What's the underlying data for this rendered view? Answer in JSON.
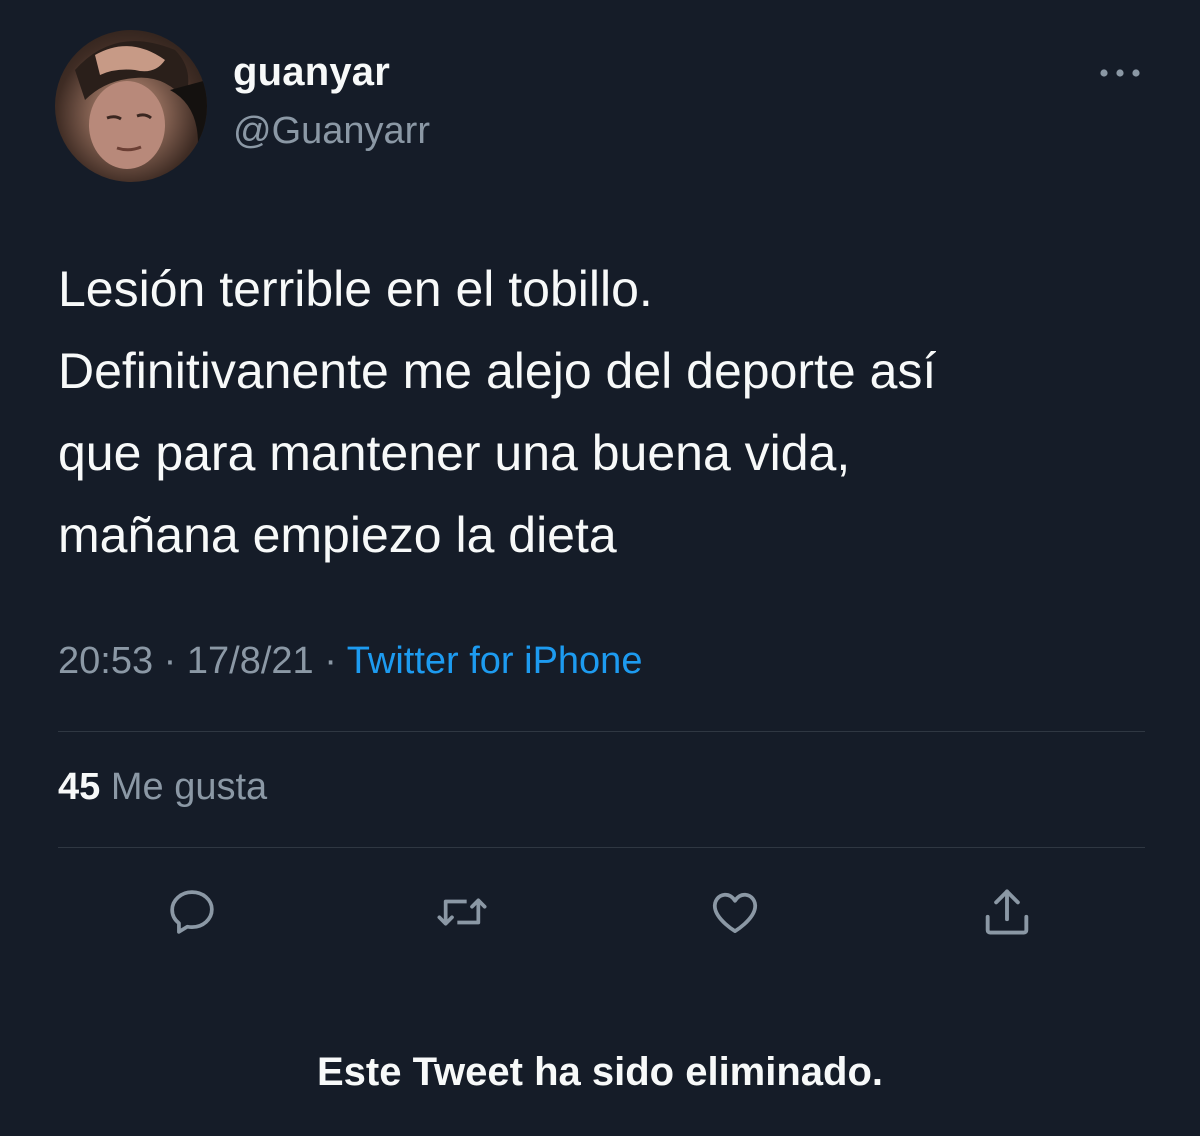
{
  "user": {
    "display_name": "guanyar",
    "handle": "@Guanyarr",
    "avatar_icon": "profile-photo"
  },
  "tweet": {
    "lines": [
      "Lesión terrible en el tobillo.",
      "Definitivanente me alejo del deporte así",
      "que para mantener una buena vida,",
      "mañana empiezo la dieta"
    ],
    "time": "20:53",
    "separator": "·",
    "date": "17/8/21",
    "source": "Twitter for iPhone"
  },
  "stats": {
    "likes_count": "45",
    "likes_label": "Me gusta"
  },
  "actions": {
    "reply_icon": "reply-icon",
    "retweet_icon": "retweet-icon",
    "like_icon": "heart-icon",
    "share_icon": "share-icon",
    "more_icon": "more-dots-icon"
  },
  "notice": {
    "deleted_text": "Este Tweet ha sido eliminado."
  },
  "colors": {
    "background": "#151c28",
    "primary_text": "#f7f9f9",
    "secondary_text": "#8b98a5",
    "link": "#1d9bf0",
    "divider": "#2f3742"
  }
}
